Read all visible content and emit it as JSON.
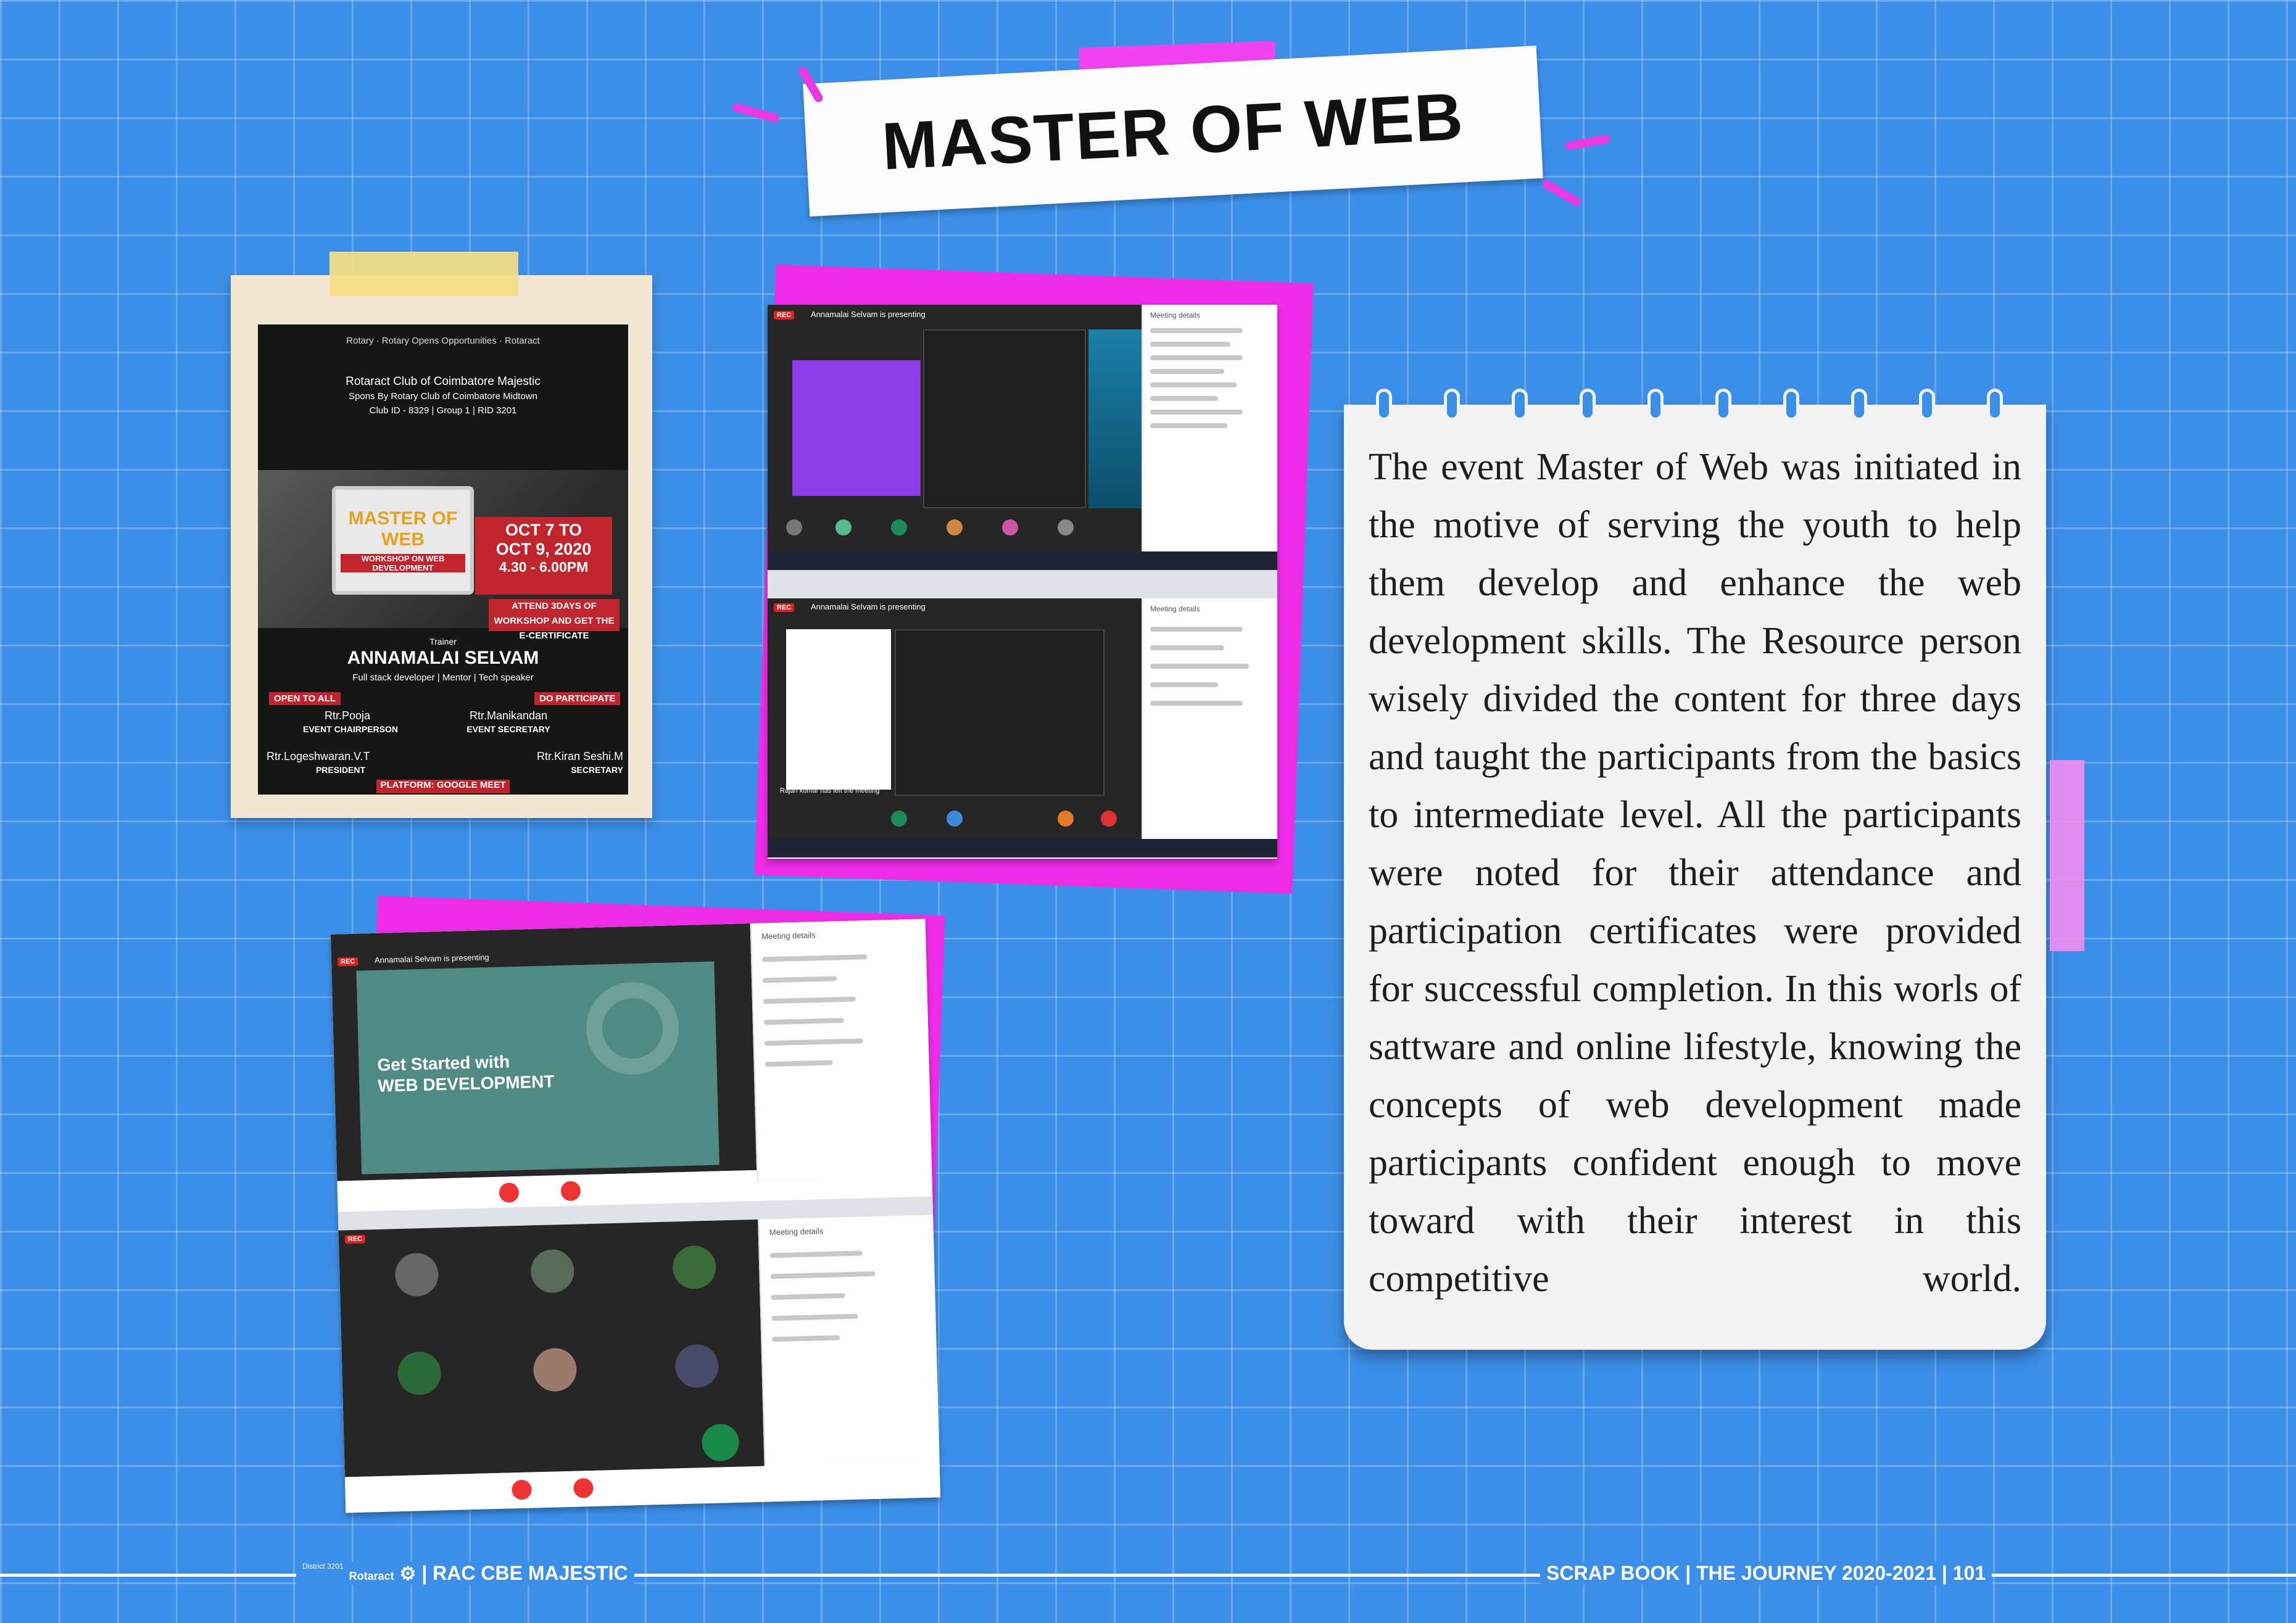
{
  "title": "MASTER OF WEB",
  "poster": {
    "logos_line": "Rotary · Rotary Opens Opportunities · Rotaract",
    "org": "Rotaract Club of Coimbatore Majestic",
    "sponsor": "Spons By Rotary Club of Coimbatore Midtown",
    "club_id": "Club ID - 8329 | Group 1 | RID 3201",
    "headline": "MASTER OF WEB",
    "subhead": "WORKSHOP ON WEB DEVELOPMENT",
    "dates_1": "OCT 7 TO",
    "dates_2": "OCT 9, 2020",
    "time": "4.30 - 6.00PM",
    "attend": "ATTEND 3DAYS OF WORKSHOP AND GET THE E-CERTIFICATE",
    "trainer_label": "Trainer",
    "trainer_name": "ANNAMALAI SELVAM",
    "trainer_role": "Full stack developer | Mentor | Tech speaker",
    "open_to_all": "OPEN TO ALL",
    "do_participate": "DO PARTICIPATE",
    "p1_name": "Rtr.Pooja",
    "p1_role": "EVENT CHAIRPERSON",
    "p2_name": "Rtr.Manikandan",
    "p2_role": "EVENT SECRETARY",
    "p3_name": "Rtr.Logeshwaran.V.T",
    "p3_role": "PRESIDENT",
    "p4_name": "Rtr.Kiran Seshi.M",
    "p4_role": "SECRETARY",
    "platform": "PLATFORM: GOOGLE MEET"
  },
  "meet": {
    "presenting": "Annamalai Selvam is presenting",
    "panel_title": "Meeting details",
    "rec": "REC",
    "slide_line1": "Get Started with",
    "slide_line2": "WEB DEVELOPMENT",
    "left_meeting": "Rajan kumar has left the meeting"
  },
  "body_text": "The event Master of Web was initiated in the motive of  serving the youth to help them develop and enhance the web development skills. The Resource person wisely divided the content for three days and taught the participants from the basics to intermediate level. All the participants were noted for their attendance and participation certificates were provided for successful completion. In this worls of sattware and online lifestyle, knowing the concepts of web development made participants confident enough to move toward with their interest in this competitive world.",
  "footer": {
    "left": "| RAC CBE MAJESTIC",
    "district": "District 3201",
    "rotaract": "Rotaract",
    "right": "SCRAP BOOK | THE JOURNEY 2020-2021 | 101"
  },
  "colors": {
    "background": "#3c8fe8",
    "accent_pink": "#ef2de8",
    "poster_red": "#c0242c"
  }
}
